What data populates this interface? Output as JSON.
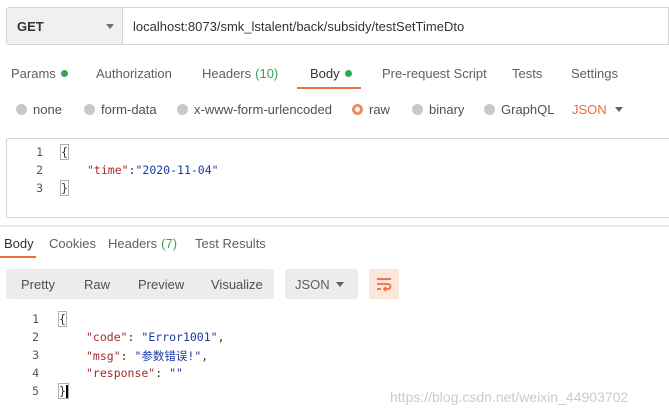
{
  "request": {
    "method": "GET",
    "url": "localhost:8073/smk_lstalent/back/subsidy/testSetTimeDto"
  },
  "request_tabs": {
    "params": "Params",
    "authorization": "Authorization",
    "headers": "Headers",
    "headers_count": "(10)",
    "body": "Body",
    "prerequest": "Pre-request Script",
    "tests": "Tests",
    "settings": "Settings"
  },
  "body_options": {
    "none": "none",
    "form_data": "form-data",
    "urlencoded": "x-www-form-urlencoded",
    "raw": "raw",
    "binary": "binary",
    "graphql": "GraphQL",
    "language": "JSON",
    "selected": "raw"
  },
  "request_body": {
    "line_numbers": [
      "1",
      "2",
      "3"
    ],
    "open_brace": "{",
    "key": "\"time\"",
    "colon": ":",
    "value": "\"2020-11-04\"",
    "close_brace": "}"
  },
  "response_tabs": {
    "body": "Body",
    "cookies": "Cookies",
    "headers": "Headers",
    "headers_count": "(7)",
    "test_results": "Test Results"
  },
  "response_toolbar": {
    "pretty": "Pretty",
    "raw": "Raw",
    "preview": "Preview",
    "visualize": "Visualize",
    "format": "JSON"
  },
  "response_body": {
    "line_numbers": [
      "1",
      "2",
      "3",
      "4",
      "5"
    ],
    "open_brace": "{",
    "code_key": "\"code\"",
    "code_value": "\"Error1001\"",
    "msg_key": "\"msg\"",
    "msg_value": "\"参数错误!\"",
    "response_key": "\"response\"",
    "response_value": "\"\"",
    "close_brace": "}"
  },
  "watermark": "https://blog.csdn.net/weixin_44903702",
  "colors": {
    "accent": "#f26b3a",
    "green": "#2fa84f",
    "json_key": "#a52a2a",
    "json_string": "#1a3aa8"
  }
}
